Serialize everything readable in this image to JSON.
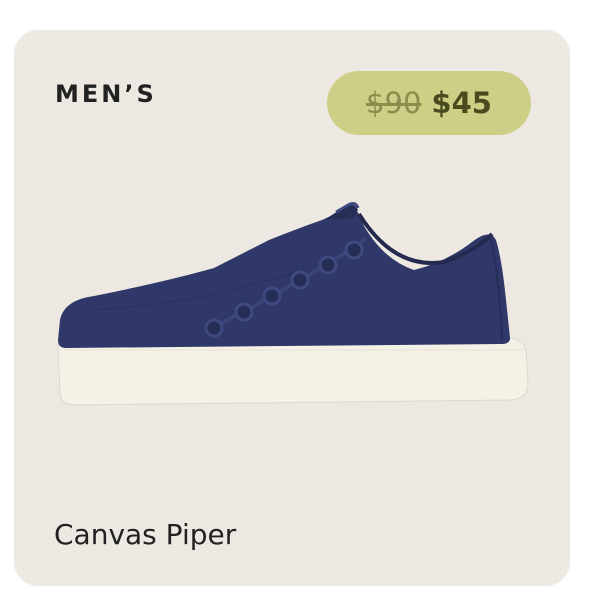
{
  "product": {
    "gender_label": "MEN’S",
    "name": "Canvas Piper",
    "price_original": "$90",
    "price_sale": "$45"
  },
  "colors": {
    "card_background": "#ede9e2",
    "price_pill": "#cccf85",
    "shoe_upper": "#2f3868",
    "shoe_sole": "#f4f1e6"
  },
  "image": {
    "icon": "sneaker-image"
  }
}
